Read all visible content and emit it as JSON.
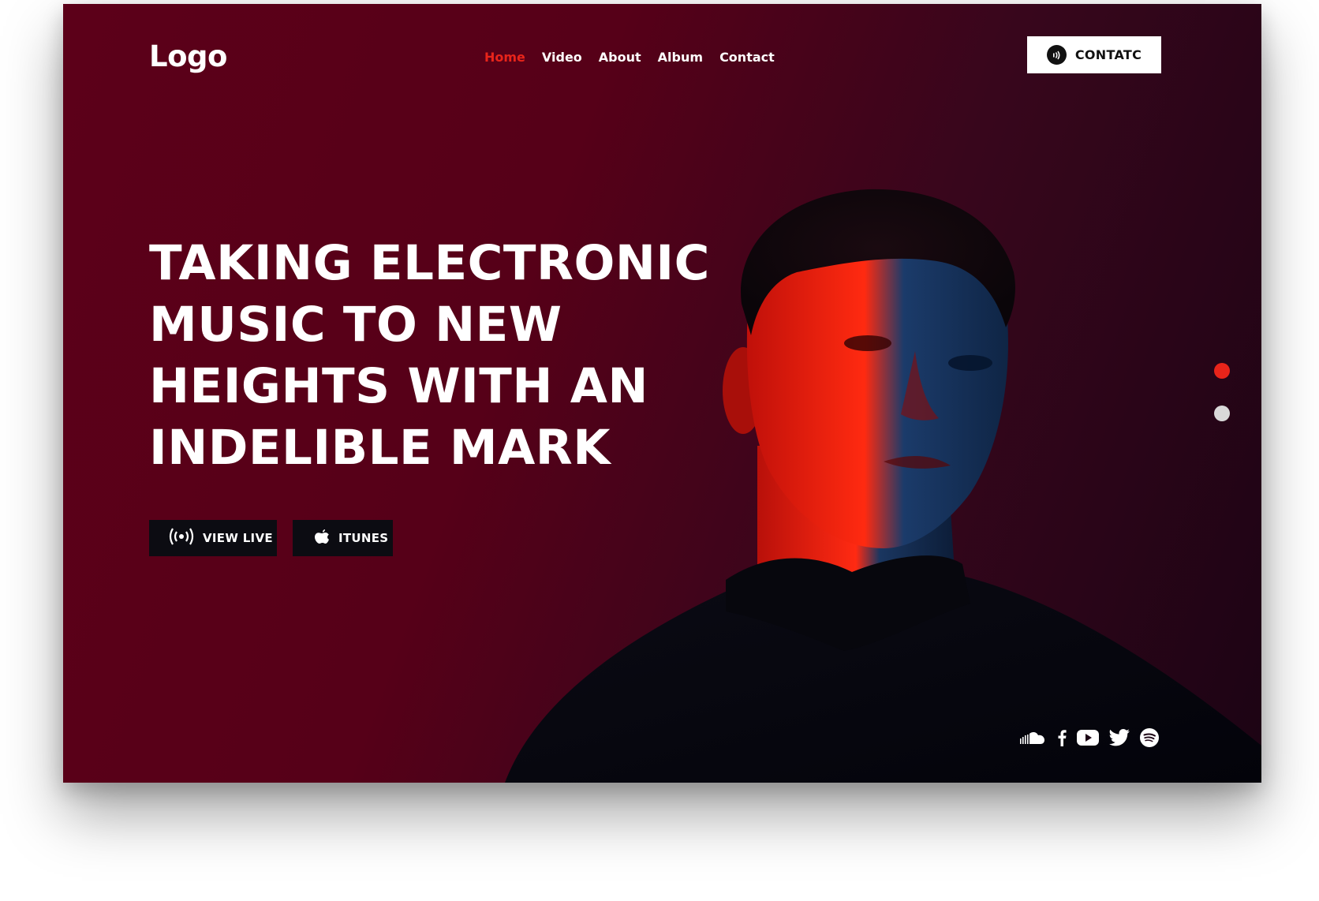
{
  "header": {
    "logo": "Logo",
    "nav": [
      {
        "label": "Home"
      },
      {
        "label": "Video"
      },
      {
        "label": "About"
      },
      {
        "label": "Album"
      },
      {
        "label": "Contact"
      }
    ],
    "contact_button": "CONTATC"
  },
  "hero": {
    "headline_lines": [
      "TAKING ELECTRONIC",
      "MUSIC TO NEW",
      "HEIGHTS WITH AN",
      "INDELIBLE MARK"
    ],
    "buttons": {
      "live": "VIEW LIVE",
      "itunes": "ITUNES"
    }
  },
  "slider": {
    "dots": [
      {
        "state": "active",
        "color": "#e8241a"
      },
      {
        "state": "inactive",
        "color": "#d9d9d9"
      }
    ]
  },
  "socials": [
    "soundcloud-icon",
    "facebook-icon",
    "youtube-icon",
    "twitter-icon",
    "spotify-icon"
  ],
  "colors": {
    "accent": "#e8241a",
    "background_left": "#5c0019",
    "background_right": "#1c0414",
    "button_dark": "#0c0c12"
  }
}
